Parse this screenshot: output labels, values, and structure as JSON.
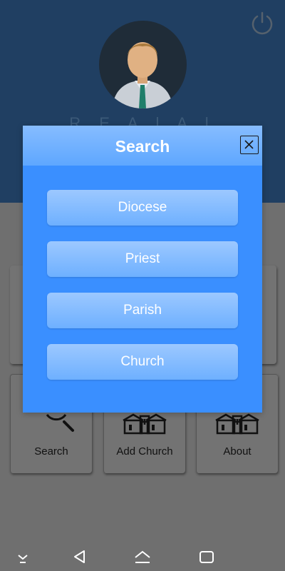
{
  "header": {
    "user_name": "R  E  A  l  A  l"
  },
  "tiles": [
    {
      "label": "Search",
      "icon": "magnifier-icon"
    },
    {
      "label": "Add Church",
      "icon": "church-buildings-icon"
    },
    {
      "label": "About",
      "icon": "church-buildings-icon"
    }
  ],
  "modal": {
    "title": "Search",
    "close_icon": "close-icon",
    "options": [
      "Diocese",
      "Priest",
      "Parish",
      "Church"
    ]
  },
  "colors": {
    "modal_bg": "#3a8fff",
    "header_bg": "#203f62",
    "overlay": "#6f6f6f"
  }
}
